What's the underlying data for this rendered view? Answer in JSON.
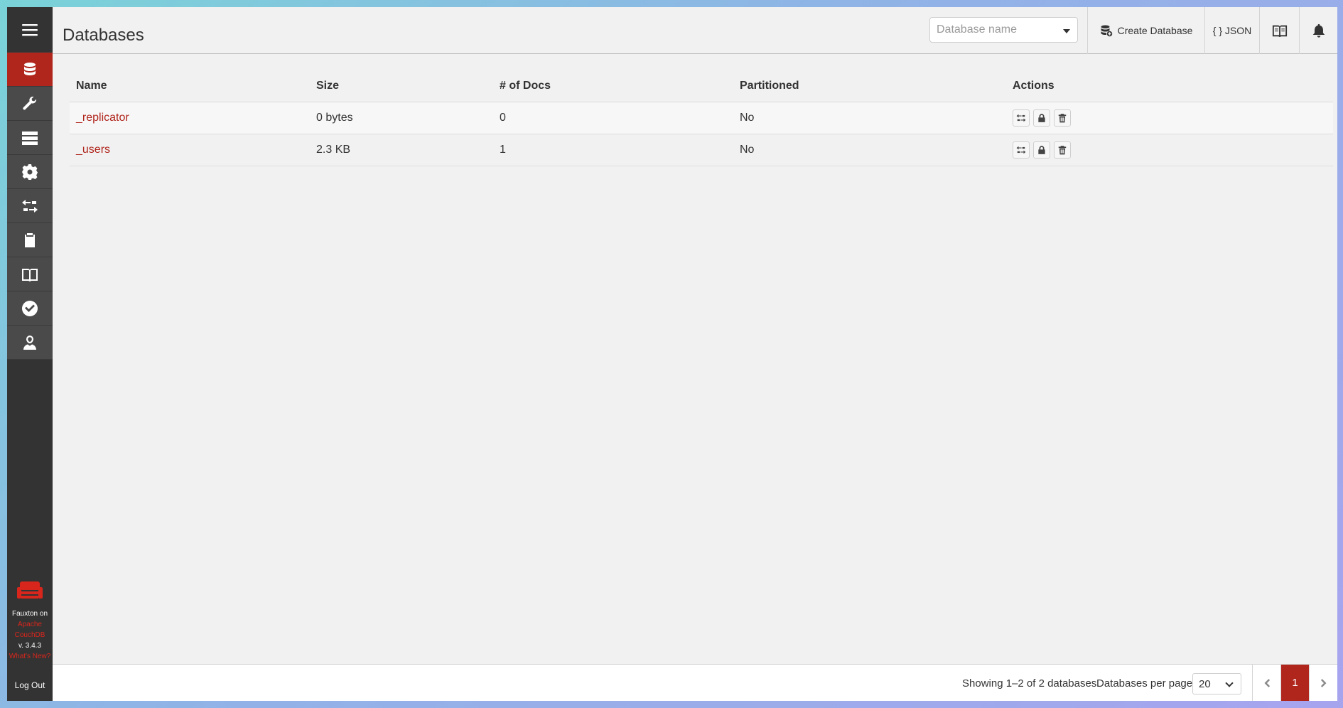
{
  "header": {
    "title": "Databases",
    "search_placeholder": "Database name",
    "create_label": "Create Database",
    "json_label": "{ } JSON"
  },
  "sidebar": {
    "items": [
      {
        "name": "databases",
        "icon": "database-icon",
        "active": true
      },
      {
        "name": "setup",
        "icon": "wrench-icon"
      },
      {
        "name": "active-tasks",
        "icon": "server-icon"
      },
      {
        "name": "config",
        "icon": "gear-icon"
      },
      {
        "name": "replication",
        "icon": "replication-icon"
      },
      {
        "name": "documentation",
        "icon": "clipboard-icon"
      },
      {
        "name": "docs",
        "icon": "book-icon"
      },
      {
        "name": "verify",
        "icon": "check-circle-icon"
      },
      {
        "name": "user",
        "icon": "user-icon"
      }
    ],
    "footer": {
      "line1": "Fauxton on",
      "line2": "Apache",
      "line3": "CouchDB",
      "version": "v. 3.4.3",
      "whats_new": "What's New?",
      "logout": "Log Out"
    }
  },
  "table": {
    "columns": [
      "Name",
      "Size",
      "# of Docs",
      "Partitioned",
      "Actions"
    ],
    "rows": [
      {
        "name": "_replicator",
        "size": "0 bytes",
        "docs": "0",
        "partitioned": "No"
      },
      {
        "name": "_users",
        "size": "2.3 KB",
        "docs": "1",
        "partitioned": "No"
      }
    ]
  },
  "footer": {
    "showing": "Showing 1–2 of 2 databases.",
    "per_page_label": "Databases per page",
    "per_page_value": "20",
    "current_page": "1"
  },
  "colors": {
    "accent": "#b0261d",
    "sidebar_bg": "#333333",
    "page_bg": "#f1f1f1"
  }
}
